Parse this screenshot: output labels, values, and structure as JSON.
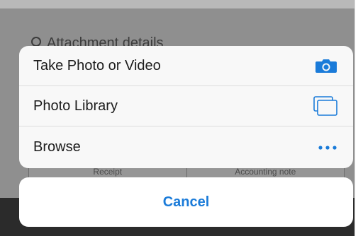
{
  "background": {
    "row_label": "Attachment details",
    "segments": [
      "Receipt",
      "Accounting note"
    ]
  },
  "action_sheet": {
    "items": [
      {
        "label": "Take Photo or Video",
        "icon": "camera-icon"
      },
      {
        "label": "Photo Library",
        "icon": "photo-stack-icon"
      },
      {
        "label": "Browse",
        "icon": "more-dots-icon"
      }
    ],
    "cancel_label": "Cancel"
  },
  "colors": {
    "accent": "#1a7bd9",
    "sheet_background": "#f8f8f8",
    "dim_overlay": "#8f8f8f"
  }
}
